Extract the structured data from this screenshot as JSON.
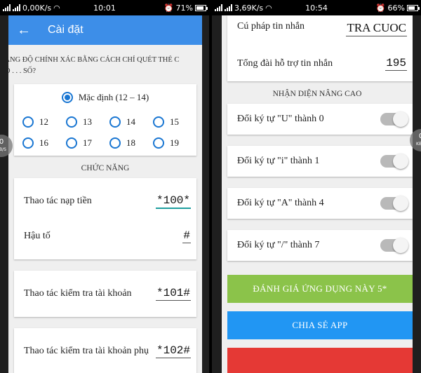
{
  "left_status": {
    "speed": "0,00K/s",
    "time": "10:01",
    "battery": "71%",
    "battery_fraction": 0.71
  },
  "right_status": {
    "speed": "3,69K/s",
    "time": "10:54",
    "battery": "66%",
    "battery_fraction": 0.66
  },
  "settings": {
    "title": "Cài đặt",
    "accuracy_text": "TĂNG ĐỘ CHÍNH XÁC BẰNG CÁCH CHỈ QUÉT THẺ C\nCÓ . . . SỐ?",
    "default_option": "Mặc định (12 – 14)",
    "options": [
      "12",
      "13",
      "14",
      "15",
      "16",
      "17",
      "18",
      "19"
    ],
    "functions_header": "CHỨC NĂNG",
    "topup_label": "Thao tác nạp tiền",
    "topup_value": "*100*",
    "suffix_label": "Hậu tố",
    "suffix_value": "#",
    "check_label": "Thao tác kiểm tra tài khoản",
    "check_value": "*101#",
    "check_sub_label": "Thao tác kiểm tra tài khoản phụ",
    "check_sub_value": "*102#"
  },
  "advanced": {
    "syntax_label": "Cú pháp tin nhắn",
    "syntax_value": "TRA CUOC",
    "hotline_label": "Tổng đài hỗ trợ tin nhắn",
    "hotline_value": "195",
    "header": "NHẬN DIỆN NÂNG CAO",
    "toggles": [
      {
        "label": "Đổi ký tự \"U\" thành 0"
      },
      {
        "label": "Đổi ký tự \"i\" thành 1"
      },
      {
        "label": "Đổi ký tự \"A\" thành 4"
      },
      {
        "label": "Đổi ký tự \"/\" thành 7"
      }
    ],
    "rate_button": "ĐÁNH GIÁ ỨNG DỤNG NÀY 5*",
    "share_button": "CHIA SẺ APP"
  },
  "overlay": {
    "left_value": "0",
    "left_unit": "KB/S",
    "right_value": "0",
    "right_unit": "KB/S"
  },
  "colors": {
    "appbar": "#3d8ee8",
    "radio": "#1976d2",
    "rate_button": "#8bc34a",
    "share_button": "#2196f3",
    "bottom_button": "#e53935",
    "active_underline": "#1e9e9e"
  },
  "icons": {
    "back": "arrow-left-icon",
    "wifi": "wifi-icon",
    "signal": "signal-icon",
    "alarm": "alarm-icon",
    "battery": "battery-icon"
  }
}
